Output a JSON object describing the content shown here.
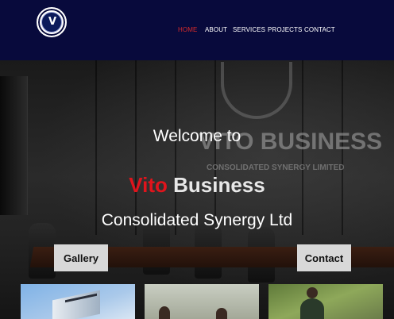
{
  "header": {
    "logo_name": "vito-business-logo",
    "logo_letter": "V",
    "nav": [
      {
        "label": "HOME",
        "active": true
      },
      {
        "label": "ABOUT",
        "active": false
      },
      {
        "label": "SERVICES",
        "active": false
      },
      {
        "label": "PROJECTS",
        "active": false
      },
      {
        "label": "CONTACT",
        "active": false
      }
    ]
  },
  "hero": {
    "welcome": "Welcome to",
    "brand_red": "Vito",
    "brand_white": "Business",
    "tagline": "Consolidated Synergy Ltd",
    "background_sign_line1": "VITO BUSINESS",
    "background_sign_line2": "CONSOLIDATED SYNERGY LIMITED"
  },
  "buttons": {
    "gallery": "Gallery",
    "contact": "Contact"
  },
  "colors": {
    "header_bg": "#080a3c",
    "active_nav": "#d42a2a",
    "brand_red": "#e0141c",
    "button_bg": "#d8d8d8"
  }
}
